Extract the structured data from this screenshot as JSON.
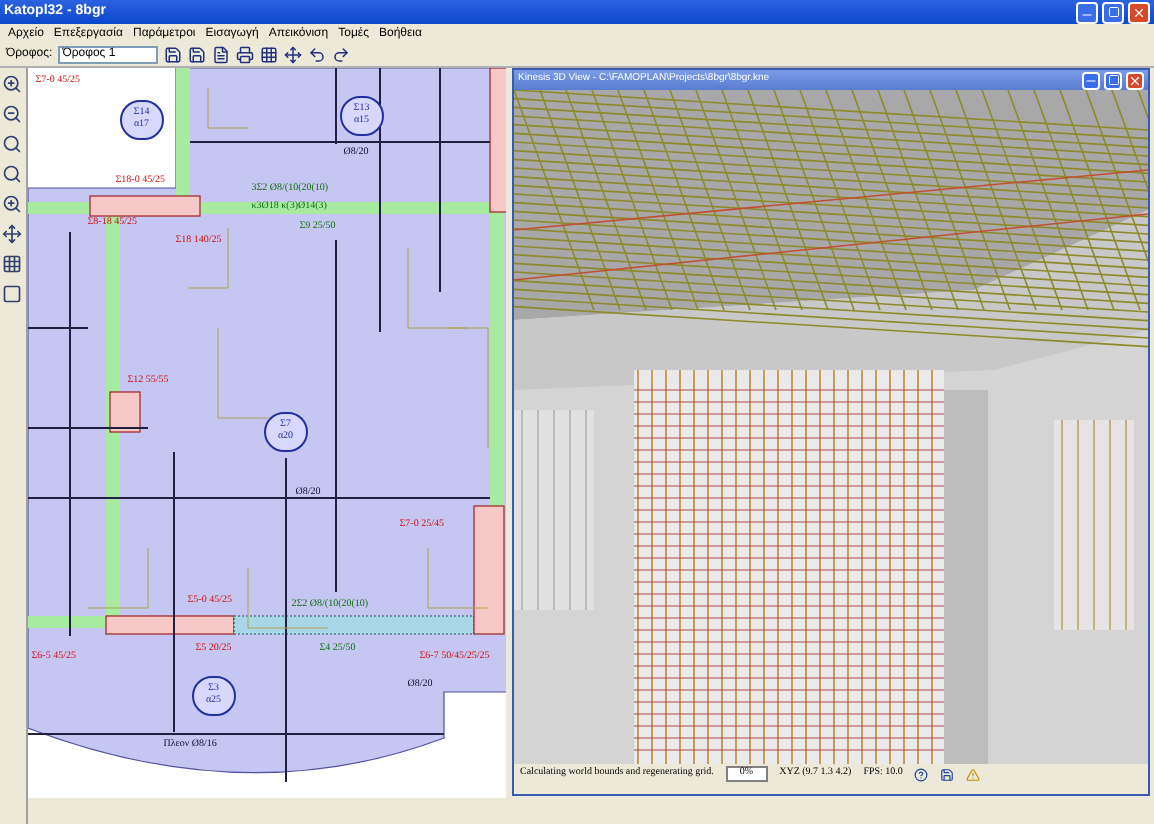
{
  "window": {
    "title": "Katopl32 - 8bgr"
  },
  "menu": [
    "Αρχείο",
    "Επεξεργασία",
    "Παράμετροι",
    "Εισαγωγή",
    "Απεικόνιση",
    "Τομές",
    "Βοήθεια"
  ],
  "toolbar": {
    "floor_label": "Όροφος:",
    "floor_value": "Όροφος 1"
  },
  "drawing": {
    "labels": [
      {
        "text": "Σ7-0 45/25",
        "kind": "column"
      },
      {
        "text": "Ø8/20",
        "kind": "slab"
      },
      {
        "text": "Σ18-0 45/25",
        "kind": "column"
      },
      {
        "text": "3Σ2 Ø8/(10(20(10)",
        "kind": "beam"
      },
      {
        "text": "κ3Ø18 κ(3)Ø14(3)",
        "kind": "beam"
      },
      {
        "text": "Σ9 25/50",
        "kind": "beam"
      },
      {
        "text": "Σ8-18 45/25",
        "kind": "column"
      },
      {
        "text": "Σ18 140/25",
        "kind": "column"
      },
      {
        "text": "Σ12 55/55",
        "kind": "column"
      },
      {
        "text": "Ø8/20",
        "kind": "slab"
      },
      {
        "text": "Σ7-0 25/45",
        "kind": "column"
      },
      {
        "text": "Σ5-0 45/25",
        "kind": "column"
      },
      {
        "text": "2Σ2 Ø8/(10(20(10)",
        "kind": "beam"
      },
      {
        "text": "Σ5 20/25",
        "kind": "column"
      },
      {
        "text": "Σ4 25/50",
        "kind": "beam"
      },
      {
        "text": "Σ6-5 45/25",
        "kind": "column"
      },
      {
        "text": "Σ6-7 50/45/25/25",
        "kind": "column"
      },
      {
        "text": "Ø8/20",
        "kind": "slab"
      },
      {
        "text": "Πλεον Ø8/16",
        "kind": "slab"
      }
    ],
    "tags": [
      {
        "top": "Σ14",
        "bottom": "α17"
      },
      {
        "top": "Σ13",
        "bottom": "α15"
      },
      {
        "top": "Σ7",
        "bottom": "α20"
      },
      {
        "top": "Σ3",
        "bottom": "α25"
      }
    ]
  },
  "viewer": {
    "title": "Kinesis 3D View - C:\\FAMOPLAN\\Projects\\8bgr\\8bgr.kne",
    "status": "Calculating world bounds and regenerating grid.",
    "progress": "0%",
    "coords": "XYZ (9.7 1.3 4.2)",
    "fps": "FPS: 10.0"
  }
}
